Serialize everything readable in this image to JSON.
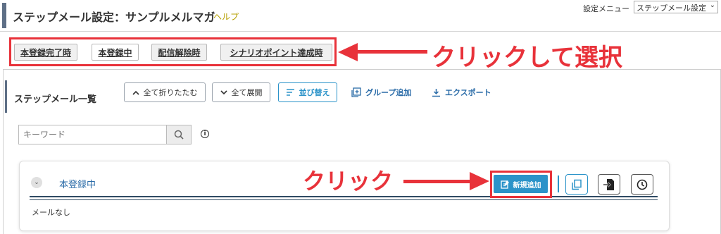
{
  "header": {
    "title": "ステップメール設定：サンプルメルマガ",
    "help": "ヘルプ",
    "settings_label": "設定メニュー",
    "settings_value": "ステップメール設定"
  },
  "tabs": [
    {
      "label": "本登録完了時"
    },
    {
      "label": "本登録中"
    },
    {
      "label": "配信解除時"
    },
    {
      "label": "シナリオポイント達成時"
    }
  ],
  "annotations": {
    "tabs_note": "クリックして選択",
    "button_note": "クリック"
  },
  "list": {
    "title": "ステップメール一覧",
    "collapse_all": "全て折りたたむ",
    "expand_all": "全て展開",
    "sort": "並び替え",
    "add_group": "グループ追加",
    "export": "エクスポート"
  },
  "search": {
    "placeholder": "キーワード"
  },
  "group": {
    "name": "本登録中",
    "empty": "メールなし",
    "new_button": "新規追加"
  },
  "colors": {
    "accent_blue": "#2b93c9",
    "annotation_red": "#e8323a",
    "help_yellow": "#b7a000"
  },
  "icons": [
    "chevron-up-icon",
    "chevron-down-icon",
    "sort-icon",
    "add-group-icon",
    "download-icon",
    "search-icon",
    "info-icon",
    "edit-icon",
    "copy-icon",
    "import-icon",
    "clock-icon"
  ]
}
